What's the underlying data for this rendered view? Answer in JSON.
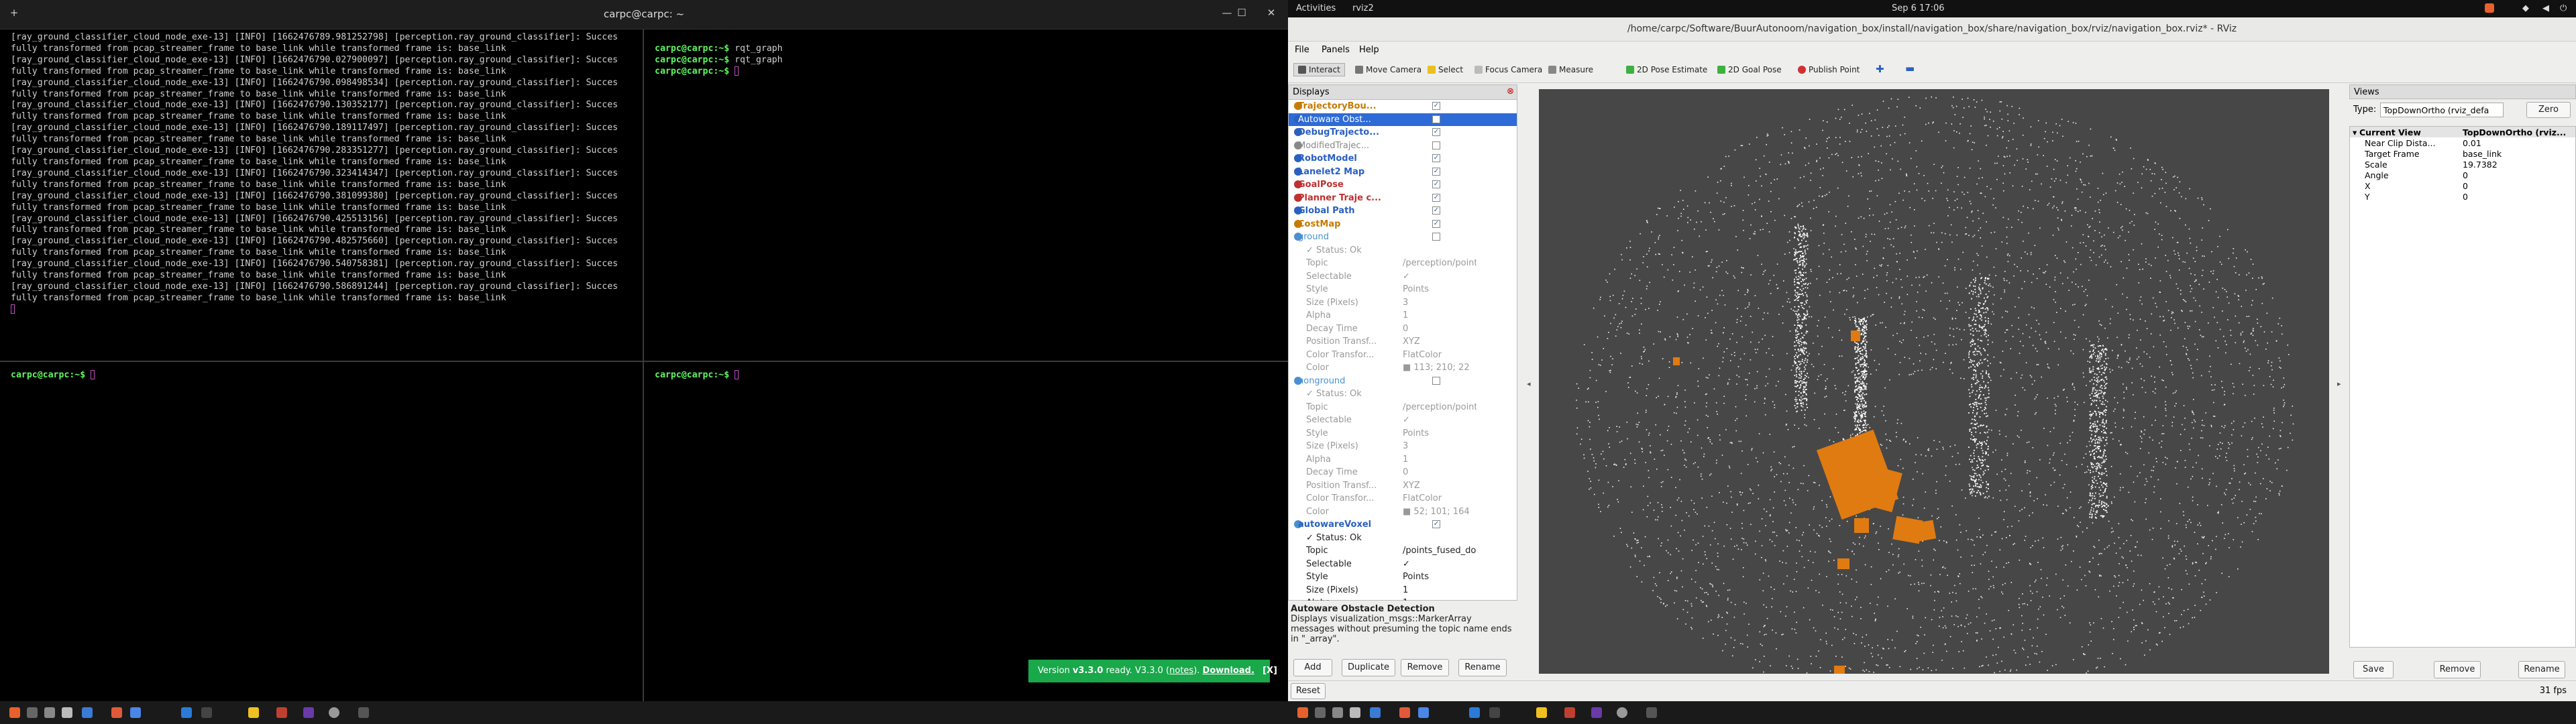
{
  "terminal": {
    "title": "carpc@carpc: ~",
    "controls": {
      "new_tab": "+",
      "minimize": "—",
      "maximize": "☐",
      "close": "✕"
    },
    "pane_top_left_lines": [
      "[ray_ground_classifier_cloud_node_exe-13] [INFO] [1662476789.981252798] [perception.ray_ground_classifier]: Succes",
      "fully transformed from pcap_streamer_frame to base_link while transformed frame is: base_link",
      "[ray_ground_classifier_cloud_node_exe-13] [INFO] [1662476790.027900097] [perception.ray_ground_classifier]: Succes",
      "fully transformed from pcap_streamer_frame to base_link while transformed frame is: base_link",
      "[ray_ground_classifier_cloud_node_exe-13] [INFO] [1662476790.098498534] [perception.ray_ground_classifier]: Succes",
      "fully transformed from pcap_streamer_frame to base_link while transformed frame is: base_link",
      "[ray_ground_classifier_cloud_node_exe-13] [INFO] [1662476790.130352177] [perception.ray_ground_classifier]: Succes",
      "fully transformed from pcap_streamer_frame to base_link while transformed frame is: base_link",
      "[ray_ground_classifier_cloud_node_exe-13] [INFO] [1662476790.189117497] [perception.ray_ground_classifier]: Succes",
      "fully transformed from pcap_streamer_frame to base_link while transformed frame is: base_link",
      "[ray_ground_classifier_cloud_node_exe-13] [INFO] [1662476790.283351277] [perception.ray_ground_classifier]: Succes",
      "fully transformed from pcap_streamer_frame to base_link while transformed frame is: base_link",
      "[ray_ground_classifier_cloud_node_exe-13] [INFO] [1662476790.323414347] [perception.ray_ground_classifier]: Succes",
      "fully transformed from pcap_streamer_frame to base_link while transformed frame is: base_link",
      "[ray_ground_classifier_cloud_node_exe-13] [INFO] [1662476790.381099380] [perception.ray_ground_classifier]: Succes",
      "fully transformed from pcap_streamer_frame to base_link while transformed frame is: base_link",
      "[ray_ground_classifier_cloud_node_exe-13] [INFO] [1662476790.425513156] [perception.ray_ground_classifier]: Succes",
      "fully transformed from pcap_streamer_frame to base_link while transformed frame is: base_link",
      "[ray_ground_classifier_cloud_node_exe-13] [INFO] [1662476790.482575660] [perception.ray_ground_classifier]: Succes",
      "fully transformed from pcap_streamer_frame to base_link while transformed frame is: base_link",
      "[ray_ground_classifier_cloud_node_exe-13] [INFO] [1662476790.540758381] [perception.ray_ground_classifier]: Succes",
      "fully transformed from pcap_streamer_frame to base_link while transformed frame is: base_link",
      "[ray_ground_classifier_cloud_node_exe-13] [INFO] [1662476790.586891244] [perception.ray_ground_classifier]: Succes",
      "fully transformed from pcap_streamer_frame to base_link while transformed frame is: base_link"
    ],
    "prompt": "carpc@carpc:~$",
    "pane_top_right_cmds": [
      "rqt_graph",
      "rqt_graph"
    ]
  },
  "version_toast": {
    "prefix": "Version ",
    "version": "v3.3.0",
    "ready": " ready. V3.3.0 (",
    "notes": "notes",
    "close_paren": "). ",
    "download": "Download.",
    "dismiss": "[X]"
  },
  "gnome": {
    "activities": "Activities",
    "app": "rviz2",
    "clock": "Sep 6  17:06"
  },
  "rviz": {
    "window_title": "/home/carpc/Software/BuurAutonoom/navigation_box/install/navigation_box/share/navigation_box/rviz/navigation_box.rviz* - RViz",
    "menu": [
      "File",
      "Panels",
      "Help"
    ],
    "tools": [
      "Interact",
      "Move Camera",
      "Select",
      "Focus Camera",
      "Measure",
      "2D Pose Estimate",
      "2D Goal Pose",
      "Publish Point"
    ],
    "displays_header": "Displays",
    "display_rows": [
      {
        "label": "TrajectoryBou...",
        "checked": "✓",
        "color": "#c77a00",
        "kind": "display"
      },
      {
        "label": "Autoware Obst...",
        "checked": "",
        "color": "#2a60c0",
        "kind": "selected"
      },
      {
        "label": "DebugTrajecto...",
        "checked": "✓",
        "color": "#2a60c0",
        "kind": "display"
      },
      {
        "label": "ModifiedTrajec...",
        "checked": "",
        "color": "#888888",
        "kind": "display"
      },
      {
        "label": "RobotModel",
        "checked": "✓",
        "color": "#2a60c0",
        "kind": "display"
      },
      {
        "label": "Lanelet2 Map",
        "checked": "✓",
        "color": "#2a60c0",
        "kind": "display"
      },
      {
        "label": "GoalPose",
        "checked": "✓",
        "color": "#c03030",
        "kind": "display"
      },
      {
        "label": "Planner Traje c...",
        "checked": "✓",
        "color": "#c03030",
        "kind": "display"
      },
      {
        "label": "Global Path",
        "checked": "✓",
        "color": "#2a60c0",
        "kind": "display"
      },
      {
        "label": "CostMap",
        "checked": "✓",
        "color": "#c77a00",
        "kind": "display"
      },
      {
        "label": "ground",
        "checked": "",
        "color": "#4a90d0",
        "kind": "display"
      },
      {
        "label": "✓ Status: Ok",
        "value": "",
        "kind": "prop"
      },
      {
        "label": "Topic",
        "value": "/perception/points_g...",
        "kind": "prop"
      },
      {
        "label": "Selectable",
        "value": "✓",
        "kind": "prop"
      },
      {
        "label": "Style",
        "value": "Points",
        "kind": "prop"
      },
      {
        "label": "Size (Pixels)",
        "value": "3",
        "kind": "prop"
      },
      {
        "label": "Alpha",
        "value": "1",
        "kind": "prop"
      },
      {
        "label": "Decay Time",
        "value": "0",
        "kind": "prop"
      },
      {
        "label": "Position Transf...",
        "value": "XYZ",
        "kind": "prop"
      },
      {
        "label": "Color Transfor...",
        "value": "FlatColor",
        "kind": "prop"
      },
      {
        "label": "Color",
        "value": "■ 113; 210; 22",
        "kind": "prop"
      },
      {
        "label": "nonground",
        "checked": "",
        "color": "#4a90d0",
        "kind": "display"
      },
      {
        "label": "✓ Status: Ok",
        "value": "",
        "kind": "prop"
      },
      {
        "label": "Topic",
        "value": "/perception/points_n...",
        "kind": "prop"
      },
      {
        "label": "Selectable",
        "value": "✓",
        "kind": "prop"
      },
      {
        "label": "Style",
        "value": "Points",
        "kind": "prop"
      },
      {
        "label": "Size (Pixels)",
        "value": "3",
        "kind": "prop"
      },
      {
        "label": "Alpha",
        "value": "1",
        "kind": "prop"
      },
      {
        "label": "Decay Time",
        "value": "0",
        "kind": "prop"
      },
      {
        "label": "Position Transf...",
        "value": "XYZ",
        "kind": "prop"
      },
      {
        "label": "Color Transfor...",
        "value": "FlatColor",
        "kind": "prop"
      },
      {
        "label": "Color",
        "value": "■ 52; 101; 164",
        "kind": "prop"
      },
      {
        "label": "autowareVoxel",
        "checked": "✓",
        "color": "#4a90d0",
        "kind": "display-blue"
      },
      {
        "label": "✓ Status: Ok",
        "value": "",
        "kind": "prop-act"
      },
      {
        "label": "Topic",
        "value": "/points_fused_downs...",
        "kind": "prop-act"
      },
      {
        "label": "Selectable",
        "value": "✓",
        "kind": "prop-act"
      },
      {
        "label": "Style",
        "value": "Points",
        "kind": "prop-act"
      },
      {
        "label": "Size (Pixels)",
        "value": "1",
        "kind": "prop-act"
      },
      {
        "label": "Alpha",
        "value": "1",
        "kind": "prop-act"
      }
    ],
    "description_title": "Autoware Obstacle Detection",
    "description_text": "Displays visualization_msgs::MarkerArray messages without presuming the topic name ends in \"_array\".",
    "display_buttons": [
      "Add",
      "Duplicate",
      "Remove",
      "Rename"
    ],
    "views": {
      "header": "Views",
      "type_label": "Type:",
      "type_value": "TopDownOrtho (rviz_defa",
      "zero": "Zero",
      "current_view": "Current View",
      "current_view_value": "TopDownOrtho (rviz...",
      "rows": [
        {
          "k": "Near Clip Dista...",
          "v": "0.01"
        },
        {
          "k": "Target Frame",
          "v": "base_link"
        },
        {
          "k": "Scale",
          "v": "19.7382"
        },
        {
          "k": "Angle",
          "v": "0"
        },
        {
          "k": "X",
          "v": "0"
        },
        {
          "k": "Y",
          "v": "0"
        }
      ],
      "buttons": [
        "Save",
        "Remove",
        "Rename"
      ]
    },
    "status": {
      "reset": "Reset",
      "fps": "31 fps"
    }
  },
  "colors": {
    "prompt_green": "#5ff85f",
    "toast_green": "#19a84a",
    "orange": "#e07b12",
    "selection": "#2e6bd6"
  }
}
